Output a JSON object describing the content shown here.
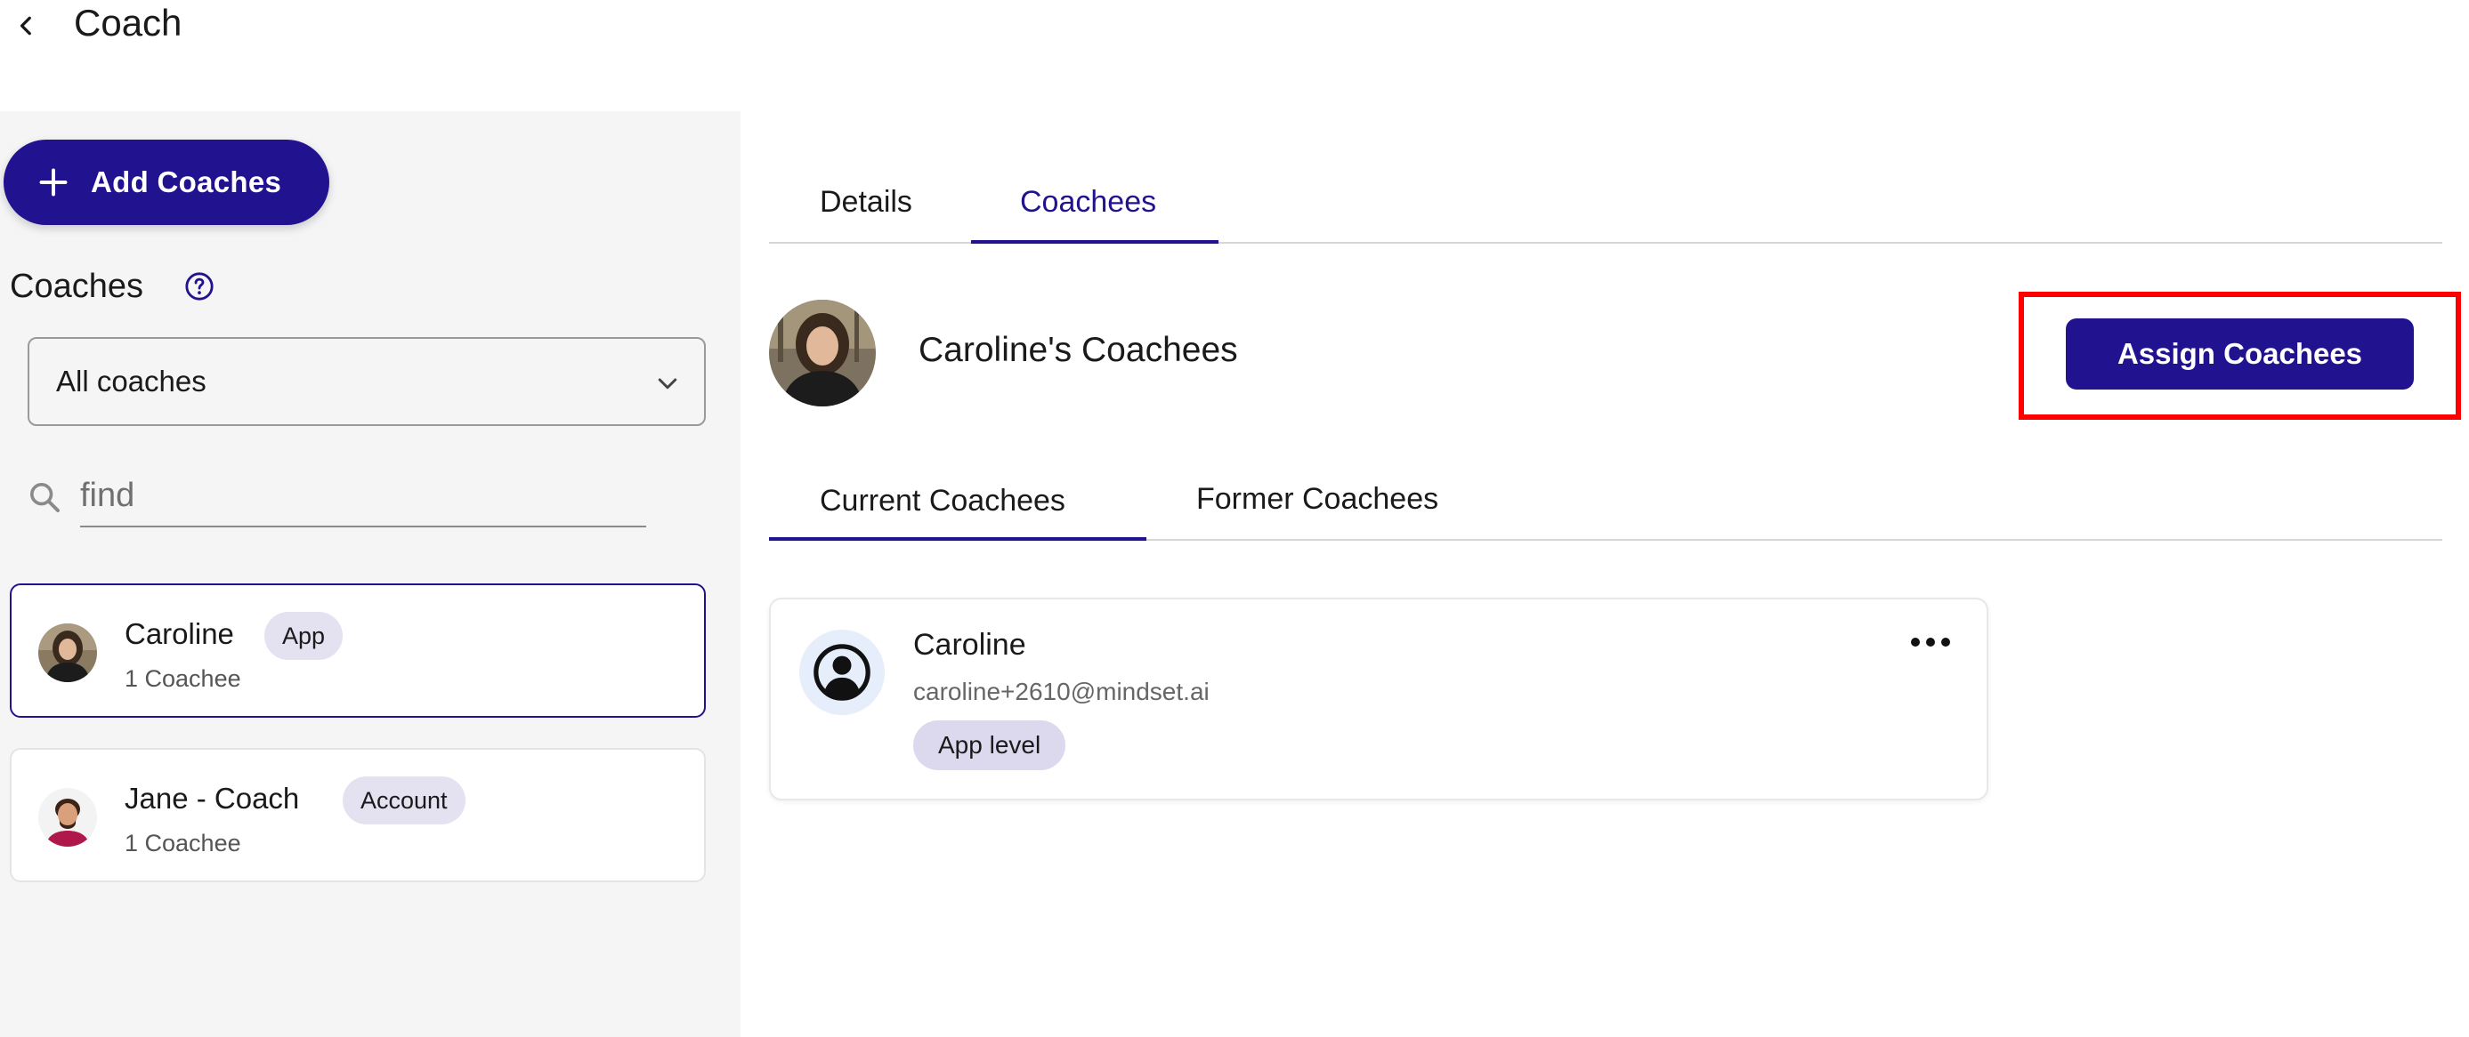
{
  "header": {
    "title": "Coach",
    "back_icon": "chevron-left-icon"
  },
  "sidebar": {
    "add_button_label": "Add Coaches",
    "coaches_heading": "Coaches",
    "help_icon": "question-circle-icon",
    "filter": {
      "selected": "All coaches"
    },
    "search": {
      "placeholder": "find",
      "value": ""
    },
    "coaches": [
      {
        "name": "Caroline",
        "badge": "App",
        "subtitle": "1 Coachee",
        "selected": true
      },
      {
        "name": "Jane - Coach",
        "badge": "Account",
        "subtitle": "1 Coachee",
        "selected": false
      }
    ]
  },
  "main": {
    "tabs": [
      {
        "label": "Details",
        "active": false
      },
      {
        "label": "Coachees",
        "active": true
      }
    ],
    "coachees_title": "Caroline's Coachees",
    "assign_button_label": "Assign Coachees",
    "sub_tabs": [
      {
        "label": "Current Coachees",
        "active": true
      },
      {
        "label": "Former Coachees",
        "active": false
      }
    ],
    "coachee_cards": [
      {
        "name": "Caroline",
        "email": "caroline+2610@mindset.ai",
        "badge": "App level"
      }
    ]
  },
  "colors": {
    "accent": "#21138f",
    "highlight": "#ff0000",
    "sidebar_bg": "#f5f5f5",
    "badge_bg": "#e4e1f1"
  }
}
